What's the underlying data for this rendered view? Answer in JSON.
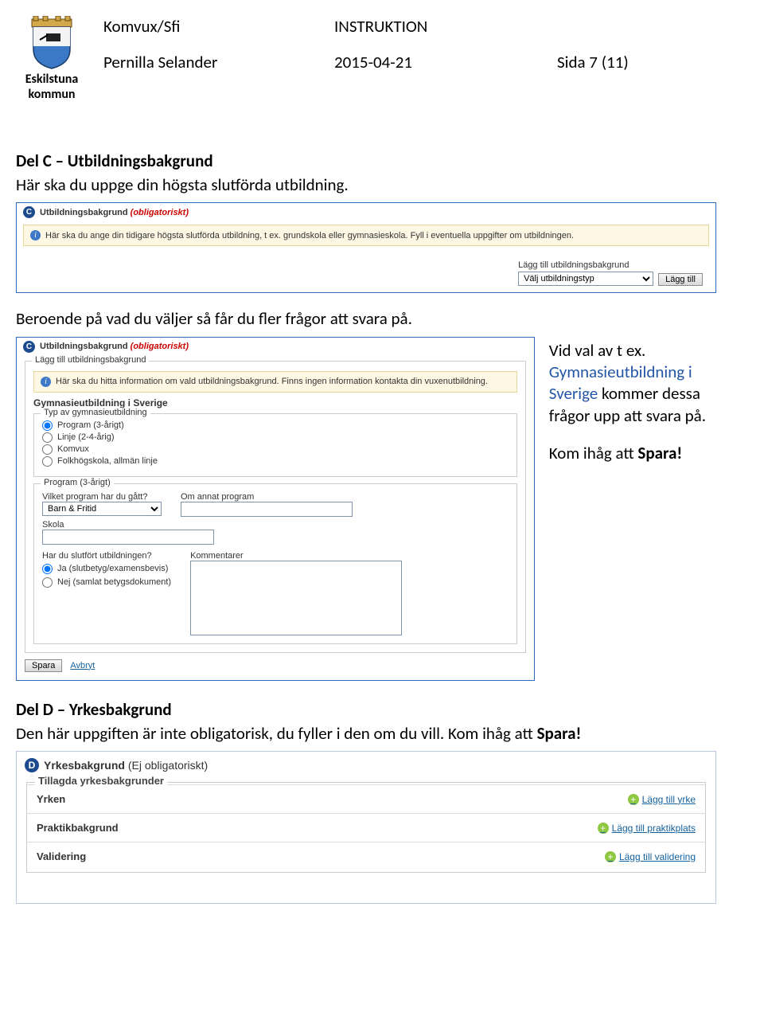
{
  "header": {
    "logo_name1": "Eskilstuna",
    "logo_name2": "kommun",
    "left1": "Komvux/Sfi",
    "right1": "INSTRUKTION",
    "left2": "Pernilla Selander",
    "date": "2015-04-21",
    "page": "Sida 7 (11)"
  },
  "sectionC": {
    "heading": "Del C – Utbildningsbakgrund",
    "intro": "Här ska du uppge din högsta slutförda utbildning.",
    "panel1": {
      "badge": "C",
      "title": "Utbildningsbakgrund",
      "oblig": "(obligatoriskt)",
      "info": "Här ska du ange din tidigare högsta slutförda utbildning, t ex. grundskola eller gymnasieskola. Fyll i eventuella uppgifter om utbildningen.",
      "add_label": "Lägg till utbildningsbakgrund",
      "select_value": "Välj utbildningstyp",
      "add_btn": "Lägg till"
    },
    "between": "Beroende på vad du väljer så får du fler frågor att svara på.",
    "panel2": {
      "badge": "C",
      "title": "Utbildningsbakgrund",
      "oblig": "(obligatoriskt)",
      "legend1": "Lägg till utbildningsbakgrund",
      "info": "Här ska du hitta information om vald utbildningsbakgrund. Finns ingen information kontakta din vuxenutbildning.",
      "sub_heading": "Gymnasieutbildning i Sverige",
      "type_legend": "Typ av gymnasieutbildning",
      "radios_type": [
        "Program (3-årigt)",
        "Linje (2-4-årig)",
        "Komvux",
        "Folkhögskola, allmän linje"
      ],
      "group2_legend": "Program (3-årigt)",
      "q_program": "Vilket program har du gått?",
      "program_selected": "Barn & Fritid",
      "q_other": "Om annat program",
      "q_school": "Skola",
      "q_completed": "Har du slutfört utbildningen?",
      "radios_completed": [
        "Ja (slutbetyg/examensbevis)",
        "Nej (samlat betygsdokument)"
      ],
      "q_comments": "Kommentarer",
      "save": "Spara",
      "cancel": "Avbryt"
    },
    "side_note": {
      "line1": "Vid val av t ex.",
      "gym": "Gymnasieutbildning i Sverige",
      "after": " kommer dessa frågor upp att svara på.",
      "remember_pre": "Kom ihåg att ",
      "remember_strong": "Spara!"
    }
  },
  "sectionD": {
    "heading": "Del D – Yrkesbakgrund",
    "intro_pre": "Den här uppgiften är inte obligatorisk, du fyller i den om du vill. Kom ihåg att ",
    "intro_strong": "Spara!",
    "panel": {
      "badge": "D",
      "title": "Yrkesbakgrund",
      "notoblig": "(Ej obligatoriskt)",
      "inner_title": "Tillagda yrkesbakgrunder",
      "rows": [
        {
          "label": "Yrken",
          "link": "Lägg till yrke"
        },
        {
          "label": "Praktikbakgrund",
          "link": "Lägg till praktikplats"
        },
        {
          "label": "Validering",
          "link": "Lägg till validering"
        }
      ]
    }
  }
}
